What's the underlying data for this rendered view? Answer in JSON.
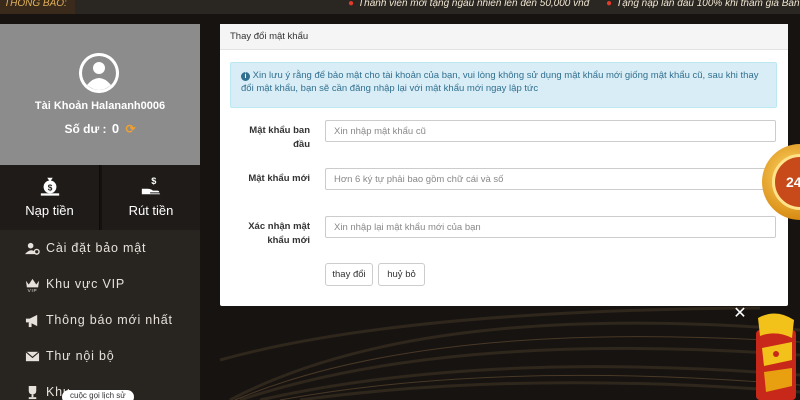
{
  "ticker": {
    "label": "THÔNG BÁO:",
    "messages": [
      "Thành viên mới tặng ngẫu nhiên lên đến 50,000 vnđ",
      "Tặng nạp lần đầu 100% khi tham gia Bắn cá - Nổ hũ"
    ]
  },
  "profile": {
    "account_name": "Tài Khoản Halananh0006",
    "balance_label": "Số dư :",
    "balance_value": "0"
  },
  "actions": {
    "deposit": "Nạp tiền",
    "withdraw": "Rút tiền"
  },
  "menu": [
    {
      "label": "Cài đặt bảo mật",
      "icon": "user-gear-icon"
    },
    {
      "label": "Khu vực VIP",
      "icon": "vip-crown-icon"
    },
    {
      "label": "Thông báo mới nhất",
      "icon": "megaphone-icon"
    },
    {
      "label": "Thư nội bộ",
      "icon": "envelope-icon"
    },
    {
      "label": "Khu",
      "icon": "trophy-icon"
    }
  ],
  "tooltip": "cuộc gọi lịch sử",
  "panel": {
    "title": "Thay đổi mật khẩu",
    "alert": "Xin lưu ý rằng để bảo mật cho tài khoản của bạn, vui lòng không sử dụng mật khẩu mới giống mật khẩu cũ, sau khi thay đổi mật khẩu, bạn sẽ cần đăng nhập lại với mật khẩu mới ngay lập tức",
    "fields": [
      {
        "label": "Mật khẩu ban đầu",
        "placeholder": "Xin nhập mật khẩu cũ"
      },
      {
        "label": "Mật khẩu mới",
        "placeholder": "Hơn 6 ký tự phải bao gồm chữ cái và số"
      },
      {
        "label": "Xác nhận mật khẩu mới",
        "placeholder": "Xin nhập lại mật khẩu mới của bạn"
      }
    ],
    "submit_label": "thay đổi",
    "cancel_label": "huỷ bỏ"
  },
  "badge": {
    "number": "24"
  },
  "colors": {
    "sidebar_bg": "#282420",
    "profile_bg": "#8c8c8c",
    "alert_bg": "#d9edf7",
    "alert_text": "#31708f",
    "refresh_accent": "#f0a030"
  }
}
